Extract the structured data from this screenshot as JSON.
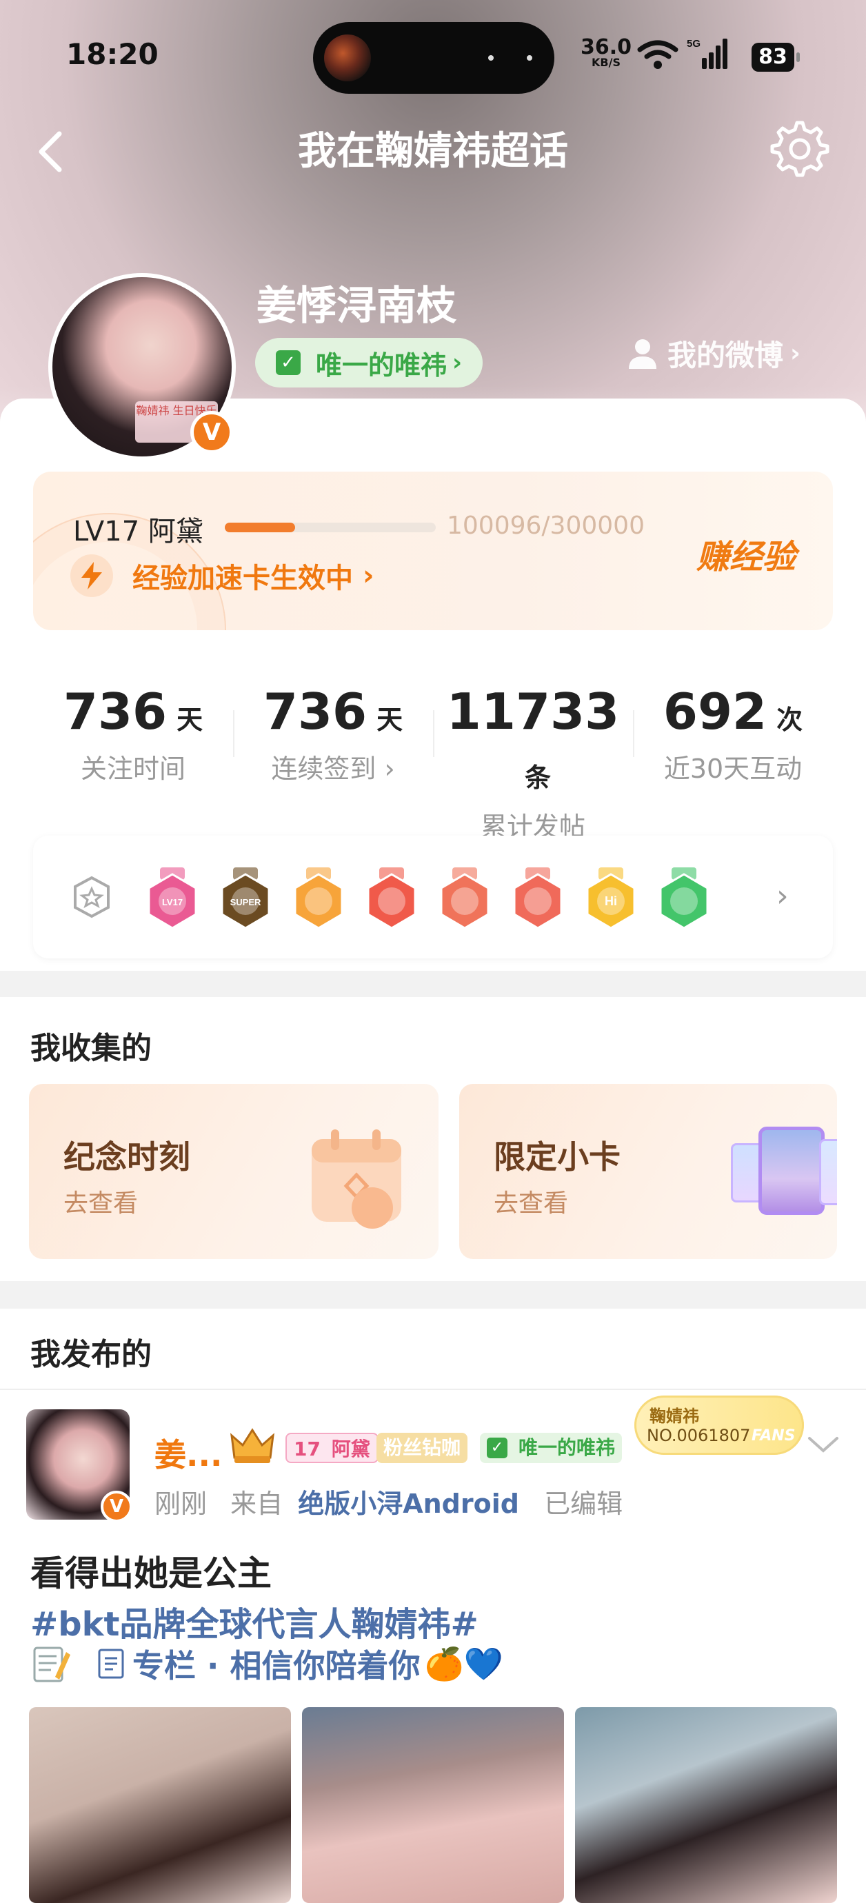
{
  "status_bar": {
    "time": "18:20",
    "net_speed": "36.0",
    "net_unit": "KB/S",
    "network": "5G",
    "battery": "83"
  },
  "nav": {
    "title": "我在鞠婧祎超话"
  },
  "profile": {
    "username": "姜悸浔南枝",
    "fan_tag": "唯一的唯祎",
    "my_weibo": "我的微博",
    "avatar_poster_text": "鞠婧祎 生日快乐"
  },
  "level": {
    "label": "LV17 阿黛",
    "progress": "100096/300000",
    "progress_fraction": 0.334,
    "boost": "经验加速卡生效中",
    "earn": "赚经验"
  },
  "stats": [
    {
      "value": "736",
      "unit": "天",
      "label": "关注时间"
    },
    {
      "value": "736",
      "unit": "天",
      "label": "连续签到 ›"
    },
    {
      "value": "11733",
      "unit": "条",
      "label": "累计发帖"
    },
    {
      "value": "692",
      "unit": "次",
      "label": "近30天互动"
    }
  ],
  "badges": {
    "items": [
      {
        "text": "LV17",
        "color": "#ea5a93"
      },
      {
        "text": "SUPER",
        "color": "#6b4b22"
      },
      {
        "text": "",
        "color": "#f7a43a"
      },
      {
        "text": "",
        "color": "#f05a4a"
      },
      {
        "text": "",
        "color": "#f0735a"
      },
      {
        "text": "",
        "color": "#f06a5a"
      },
      {
        "text": "Hi",
        "color": "#f7bf2e"
      },
      {
        "text": "",
        "color": "#43c56a"
      }
    ]
  },
  "collected": {
    "title": "我收集的",
    "cards": [
      {
        "title": "纪念时刻",
        "sub": "去查看"
      },
      {
        "title": "限定小卡",
        "sub": "去查看"
      }
    ]
  },
  "posted": {
    "title": "我发布的",
    "post": {
      "name": "姜...",
      "level_chip": "17",
      "level_name": "阿黛",
      "fan_chip": "粉丝钻咖",
      "group_chip": "唯一的唯祎",
      "meta_time": "刚刚",
      "meta_from": "来自",
      "meta_source": "绝版小浔Android",
      "meta_edited": "已编辑",
      "fans_card_name": "鞠婧祎",
      "fans_card_no": "NO.0061807",
      "fans_card_label": "FANS",
      "line1": "看得出她是公主",
      "line2": "#bkt品牌全球代言人鞠婧祎#",
      "line3": "专栏 · 相信你陪着你",
      "line3_emoji": "🍊💙"
    }
  },
  "colors": {
    "accent_orange": "#f07b12",
    "link_blue": "#4c6fa8",
    "green_tag": "#3aa847"
  }
}
